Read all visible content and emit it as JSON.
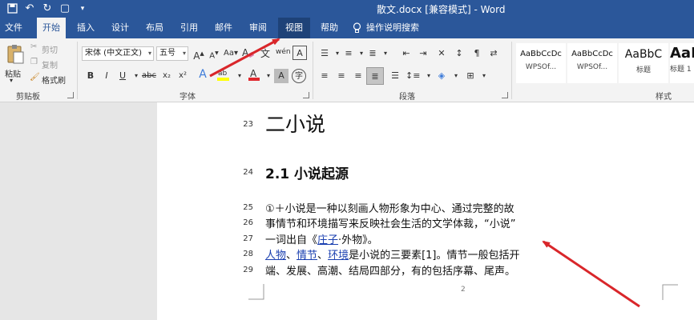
{
  "titlebar": {
    "title": "散文.docx [兼容模式] - Word"
  },
  "tabs": [
    {
      "label": "文件"
    },
    {
      "label": "开始"
    },
    {
      "label": "插入"
    },
    {
      "label": "设计"
    },
    {
      "label": "布局"
    },
    {
      "label": "引用"
    },
    {
      "label": "邮件"
    },
    {
      "label": "审阅"
    },
    {
      "label": "视图"
    },
    {
      "label": "帮助"
    }
  ],
  "tellme": {
    "label": "操作说明搜索"
  },
  "ribbon": {
    "clipboard": {
      "paste": "粘贴",
      "cut": "剪切",
      "copy": "复制",
      "format_painter": "格式刷",
      "label": "剪贴板"
    },
    "font": {
      "font_name": "宋体 (中文正文)",
      "font_size": "五号",
      "label": "字体"
    },
    "paragraph": {
      "label": "段落"
    },
    "styles": {
      "label": "样式",
      "items": [
        {
          "sample": "AaBbCcDc",
          "name": "WPSOf..."
        },
        {
          "sample": "AaBbCcDc",
          "name": "WPSOf..."
        },
        {
          "sample": "AaBbC",
          "name": "标题"
        },
        {
          "sample": "AaB",
          "name": "标题 1"
        }
      ]
    }
  },
  "document": {
    "lines": [
      {
        "num": "23",
        "text": "二小说"
      },
      {
        "num": "24",
        "text": "2.1 小说起源"
      },
      {
        "num": "25",
        "text": "①＋小说是一种以刻画人物形象为中心、通过完整的故"
      },
      {
        "num": "26",
        "text": "事情节和环境描写来反映社会生活的文学体裁，“小说”"
      },
      {
        "num": "27",
        "pre": "一词出自《",
        "link": "庄子",
        "post": "·外物》。"
      },
      {
        "num": "28",
        "link1": "人物",
        "sep1": "、",
        "link2": "情节",
        "sep2": "、",
        "link3": "环境",
        "post": "是小说的三要素[1]。情节一般包括开"
      },
      {
        "num": "29",
        "text": "端、发展、高潮、结局四部分，有的包括序幕、尾声。"
      }
    ],
    "page_number": "2"
  },
  "colors": {
    "ribbon_blue": "#2b579a",
    "annotation_arrow": "#d9262a"
  }
}
